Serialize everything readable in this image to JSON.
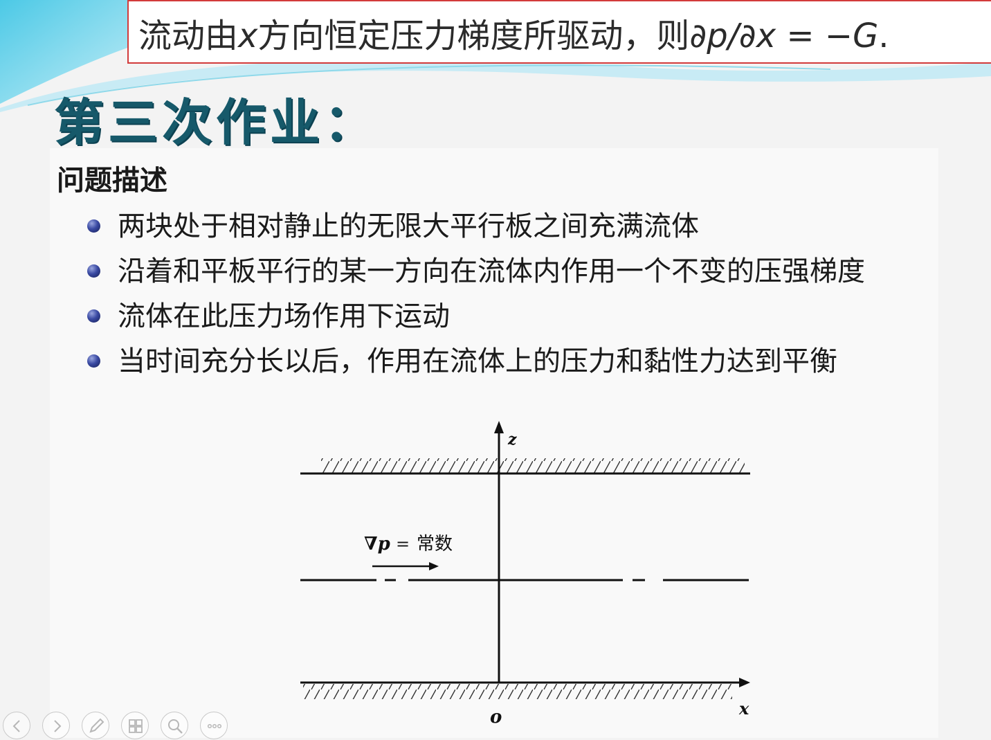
{
  "formula_bar": {
    "text_pre": "流动由",
    "var_x": "x",
    "text_mid": "方向恒定压力梯度所驱动，则",
    "expr_main": "∂p/∂x",
    "expr_eq": " = −",
    "var_g": "G",
    "expr_end": "."
  },
  "slide": {
    "title": "第三次作业：",
    "section_heading": "问题描述",
    "bullets": [
      "两块处于相对静止的无限大平行板之间充满流体",
      "沿着和平板平行的某一方向在流体内作用一个不变的压强梯度",
      "流体在此压力场作用下运动",
      "当时间充分长以后，作用在流体上的压力和黏性力达到平衡"
    ]
  },
  "diagram": {
    "z_label": "z",
    "x_label": "x",
    "origin_label": "o",
    "gradient_symbol": "∇p",
    "gradient_eq": "=",
    "gradient_value": "常数"
  },
  "nav": {
    "buttons": [
      "previous-icon",
      "next-icon",
      "pen-icon",
      "slides-icon",
      "zoom-icon",
      "more-icon"
    ]
  },
  "colors": {
    "title": "#16596a",
    "formula_border": "#d23a3a",
    "bullet": "#3a4aa3",
    "theme_cyan": "#5ecfe8"
  }
}
